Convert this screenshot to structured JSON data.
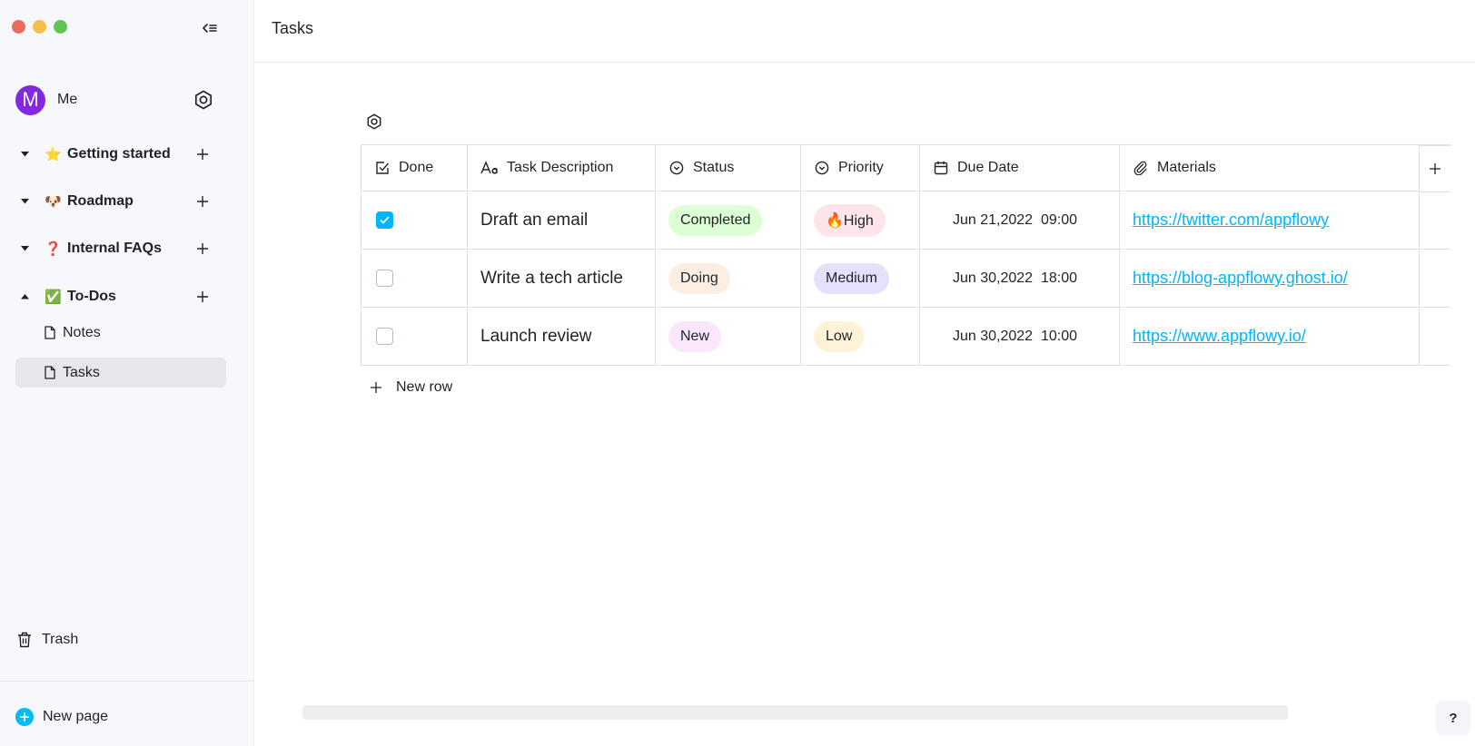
{
  "window": {
    "title": "Tasks"
  },
  "sidebar": {
    "user": {
      "avatar_letter": "M",
      "name": "Me",
      "avatar_color": "#8427e0"
    },
    "workspaces": [
      {
        "label": "Getting started",
        "emoji": "⭐",
        "expanded": false
      },
      {
        "label": "Roadmap",
        "emoji": "🐶",
        "expanded": false
      },
      {
        "label": "Internal FAQs",
        "emoji": "❓",
        "expanded": false
      },
      {
        "label": "To-Dos",
        "emoji": "✅",
        "expanded": true
      }
    ],
    "pages": [
      {
        "label": "Notes",
        "active": false
      },
      {
        "label": "Tasks",
        "active": true
      }
    ],
    "trash_label": "Trash",
    "new_page_label": "New page"
  },
  "grid": {
    "columns": [
      {
        "label": "Done",
        "icon": "checkbox-icon"
      },
      {
        "label": "Task Description",
        "icon": "text-icon"
      },
      {
        "label": "Status",
        "icon": "select-icon"
      },
      {
        "label": "Priority",
        "icon": "select-icon"
      },
      {
        "label": "Due Date",
        "icon": "calendar-icon"
      },
      {
        "label": "Materials",
        "icon": "attachment-icon"
      }
    ],
    "rows": [
      {
        "done": true,
        "description": "Draft an email",
        "status": "Completed",
        "status_color": "#ddffd6",
        "priority": "🔥High",
        "priority_color": "#fde5ea",
        "due": "Jun 21,2022  09:00",
        "materials": "https://twitter.com/appflowy"
      },
      {
        "done": false,
        "description": "Write a tech article",
        "status": "Doing",
        "status_color": "#fdeee3",
        "priority": "Medium",
        "priority_color": "#e6e0fd",
        "due": "Jun 30,2022  18:00",
        "materials": "https://blog-appflowy.ghost.io/"
      },
      {
        "done": false,
        "description": "Launch review",
        "status": "New",
        "status_color": "#fce6fd",
        "priority": "Low",
        "priority_color": "#fef3d8",
        "due": "Jun 30,2022  10:00",
        "materials": "https://www.appflowy.io/"
      }
    ],
    "new_row_label": "New row"
  },
  "help_label": "?",
  "colors": {
    "accent": "#00b5ff",
    "sidebar_bg": "#f7f8fc"
  }
}
